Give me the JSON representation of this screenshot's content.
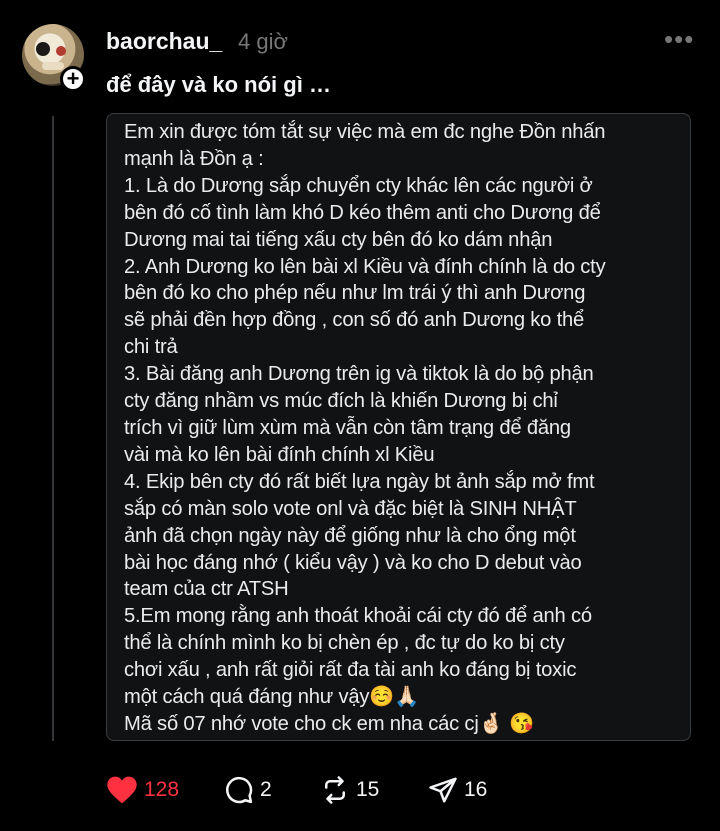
{
  "post": {
    "username": "baorchau_",
    "time": "4 giờ",
    "caption": "để đây và ko nói gì …",
    "more_label": "•••",
    "card_lines": [
      "Em xin được tóm tắt sự việc mà em đc nghe Đồn nhấn",
      "mạnh là Đồn ạ :",
      "1. Là do Dương sắp chuyển cty khác lên các người ở",
      "bên đó cố tình làm khó D kéo thêm anti cho Dương để",
      "Dương mai tai tiếng xấu cty bên đó ko dám nhận",
      "2. Anh Dương ko lên bài xl Kiều và đính chính là do cty",
      "bên đó ko cho phép nếu như lm trái ý thì anh Dương",
      "sẽ phải đền hợp đồng , con số đó anh Dương ko thể",
      "chi trả",
      "3. Bài đăng anh Dương trên ig và tiktok là do bộ phận",
      "cty đăng nhầm vs múc đích là khiến Dương bị chỉ",
      "trích vì giữ lùm xùm mà vẫn còn tâm trạng để đăng",
      "vài mà ko lên bài đính chính xl Kiều",
      "4. Ekip bên cty đó rất biết lựa ngày bt ảnh sắp mở fmt",
      "sắp có màn solo vote onl và đặc biệt là SINH NHẬT",
      "ảnh đã chọn ngày này để giống như là cho ổng một",
      "bài học đáng nhớ ( kiểu vậy ) và ko cho D debut vào",
      "team của ctr ATSH",
      "5.Em mong rằng anh thoát khoải cái cty đó để anh có",
      "thể là chính mình ko bị chèn ép , đc tự do ko bị cty",
      "chơi xấu , anh rất giỏi rất đa tài anh ko đáng bị toxic",
      "một cách quá đáng như vậy☺️🙏🏻",
      "Mã số 07 nhớ vote cho ck em nha các cj🤞🏻 😘"
    ]
  },
  "actions": {
    "likes": "128",
    "comments": "2",
    "reposts": "15",
    "shares": "16"
  },
  "colors": {
    "like": "#ff3040",
    "background": "#000000",
    "card": "#111214"
  }
}
